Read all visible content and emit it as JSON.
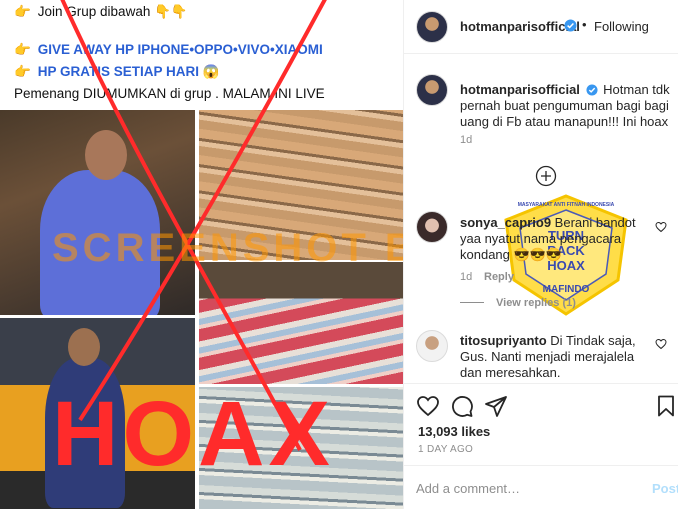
{
  "post_image": {
    "lines": [
      "Join Grup dibawah",
      "GIVE AWAY HP IPHONE•OPPO•VIVO•XIAOMI",
      "HP GRATIS SETIAP HARI",
      "Pemenang DIUMUMKAN di grup . MALAM INI LIVE"
    ],
    "watermark": "SCREENSHOT BY",
    "stamp": "HOAX"
  },
  "badge": {
    "ring_text": "MASYARAKAT ANTI FITNAH INDONESIA",
    "center_text": [
      "TURN",
      "BACK",
      "HOAX"
    ],
    "org": "MAFINDO"
  },
  "header": {
    "username": "hotmanparisofficial",
    "dot": "•",
    "follow_state": "Following"
  },
  "caption": {
    "username": "hotmanparisofficial",
    "text": "Hotman tdk pernah buat pengumuman bagi bagi uang di Fb atau manapun!!! Ini hoax",
    "time": "1d"
  },
  "comments": [
    {
      "username": "sonya_caprio9",
      "text": "Berani bandot yaa nyatut nama pengacara kondang 😎😎😎",
      "time": "1d",
      "reply_label": "Reply",
      "view_replies": "View replies (1)"
    },
    {
      "username": "titosupriyanto",
      "text": "Di Tindak saja, Gus. Nanti menjadi merajalela dan meresahkan."
    }
  ],
  "stats": {
    "likes": "13,093 likes",
    "date": "1 DAY AGO"
  },
  "comment_box": {
    "placeholder": "Add a comment…",
    "post_label": "Post"
  },
  "icons": {
    "verified": "verified-badge-icon",
    "like": "heart-icon",
    "comment": "comment-icon",
    "share": "share-icon",
    "bookmark": "bookmark-icon",
    "load_more": "plus-circle-icon"
  },
  "colors": {
    "accent_blue": "#3897f0",
    "promo_blue": "#2a5fd3",
    "hoax_red": "#ff2b2b",
    "muted": "#8e8e8e"
  }
}
